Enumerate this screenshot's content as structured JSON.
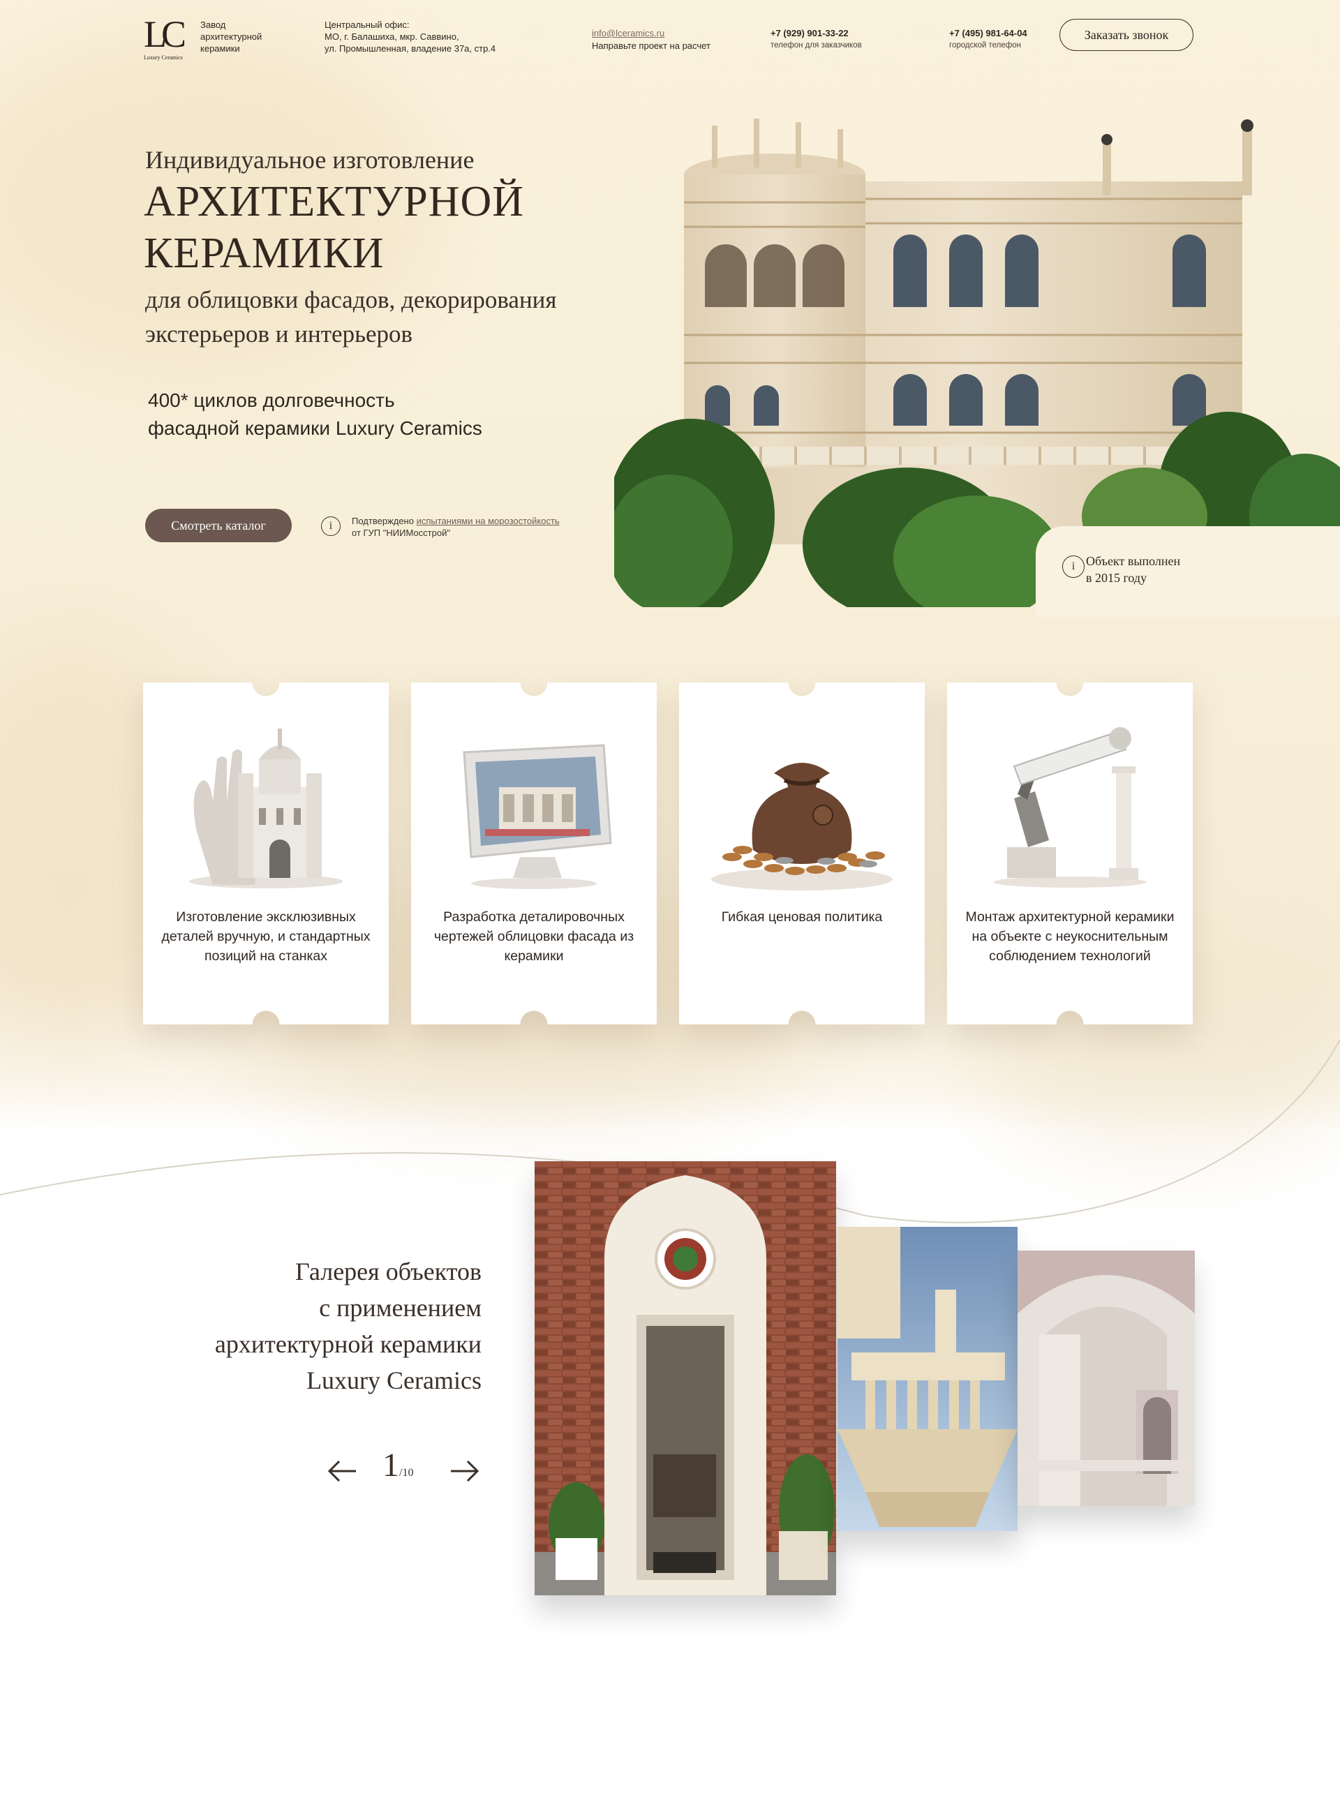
{
  "header": {
    "logo_text": "LC",
    "logo_subtext": "Luxury Ceramics",
    "company": "Завод архитектурной керамики",
    "office_label": "Центральный офис:",
    "office_line1": "МО, г. Балашиха, мкр. Саввино,",
    "office_line2": "ул. Промышленная, владение 37а, стр.4",
    "email": "info@lceramics.ru",
    "email_caption": "Направьте проект на расчет",
    "phone1": "+7 (929) 901-33-22",
    "phone1_caption": "телефон для заказчиков",
    "phone2": "+7 (495) 981-64-04",
    "phone2_caption": "городской телефон",
    "call_button": "Заказать звонок"
  },
  "hero": {
    "pretitle": "Индивидуальное изготовление",
    "title_line1": "АРХИТЕКТУРНОЙ",
    "title_line2": "КЕРАМИКИ",
    "subtitle_line1": "для облицовки фасадов, декорирования",
    "subtitle_line2": "экстерьеров и интерьеров",
    "stat_line1": "400* циклов долговечность",
    "stat_line2": "фасадной керамики Luxury Ceramics",
    "catalog_button": "Смотреть каталог",
    "confirm_prefix": "Подтверждено ",
    "confirm_link": "испытаниями  на морозостойкость",
    "confirm_suffix": "от ГУП \"НИИМосстрой\"",
    "info_icon": "i",
    "object_note_line1": "Объект выполнен",
    "object_note_line2": "в 2015 году"
  },
  "features": [
    {
      "text": "Изготовление эксклюзивных деталей вручную, и стандартных позиций на станках",
      "icon": "castle-in-hand-icon"
    },
    {
      "text": "Разработка деталировочных чертежей облицовки фасада из керамики",
      "icon": "monitor-drawing-icon"
    },
    {
      "text": "Гибкая ценовая политика",
      "icon": "money-bag-icon"
    },
    {
      "text": "Монтаж архитектурной керамики на объекте с неукоснительным соблюдением технологий",
      "icon": "robot-arm-icon"
    }
  ],
  "gallery": {
    "title_line1": "Галерея объектов",
    "title_line2": "с применением",
    "title_line3": "архитектурной керамики",
    "title_line4": "Luxury Ceramics",
    "current": "1",
    "total": "/10",
    "prev_icon": "arrow-left-icon",
    "next_icon": "arrow-right-icon"
  },
  "colors": {
    "background": "#f8efd9",
    "button": "#6c5850",
    "text": "#3b302a"
  }
}
